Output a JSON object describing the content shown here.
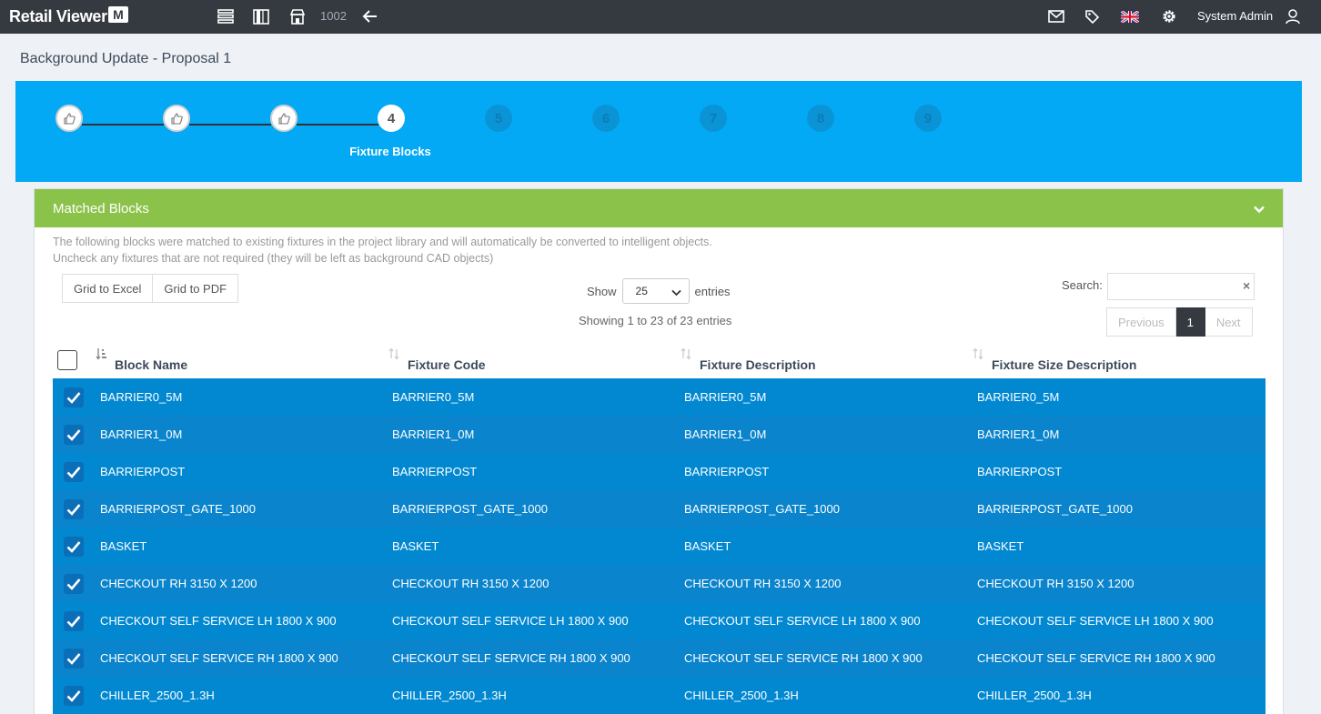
{
  "app": {
    "brand": "Retail Viewer",
    "brand_mark": "M",
    "nav_number": "1002",
    "user_name": "System Admin"
  },
  "page": {
    "title": "Background Update - Proposal 1"
  },
  "wizard": {
    "steps": [
      "",
      "",
      "",
      "4",
      "5",
      "6",
      "7",
      "8",
      "9"
    ],
    "current_label": "Fixture Blocks"
  },
  "panel": {
    "title": "Matched Blocks",
    "description_line1": "The following blocks were matched to existing fixtures in the project library and will automatically be converted to intelligent objects.",
    "description_line2": "Uncheck any fixtures that are not required (they will be left as background CAD objects)"
  },
  "toolbar": {
    "excel_label": "Grid to Excel",
    "pdf_label": "Grid to PDF"
  },
  "length": {
    "show_label": "Show",
    "value": "25",
    "entries_label": "entries"
  },
  "info": "Showing 1 to 23 of 23 entries",
  "search": {
    "label": "Search:",
    "value": "",
    "clear": "×"
  },
  "pager": {
    "previous": "Previous",
    "current": "1",
    "next": "Next"
  },
  "table": {
    "columns": [
      "Block Name",
      "Fixture Code",
      "Fixture Description",
      "Fixture Size Description"
    ],
    "rows": [
      [
        "BARRIER0_5M",
        "BARRIER0_5M",
        "BARRIER0_5M",
        "BARRIER0_5M"
      ],
      [
        "BARRIER1_0M",
        "BARRIER1_0M",
        "BARRIER1_0M",
        "BARRIER1_0M"
      ],
      [
        "BARRIERPOST",
        "BARRIERPOST",
        "BARRIERPOST",
        "BARRIERPOST"
      ],
      [
        "BARRIERPOST_GATE_1000",
        "BARRIERPOST_GATE_1000",
        "BARRIERPOST_GATE_1000",
        "BARRIERPOST_GATE_1000"
      ],
      [
        "BASKET",
        "BASKET",
        "BASKET",
        "BASKET"
      ],
      [
        "CHECKOUT RH 3150 X 1200",
        "CHECKOUT RH 3150 X 1200",
        "CHECKOUT RH 3150 X 1200",
        "CHECKOUT RH 3150 X 1200"
      ],
      [
        "CHECKOUT SELF SERVICE LH 1800 X 900",
        "CHECKOUT SELF SERVICE LH 1800 X 900",
        "CHECKOUT SELF SERVICE LH 1800 X 900",
        "CHECKOUT SELF SERVICE LH 1800 X 900"
      ],
      [
        "CHECKOUT SELF SERVICE RH 1800 X 900",
        "CHECKOUT SELF SERVICE RH 1800 X 900",
        "CHECKOUT SELF SERVICE RH 1800 X 900",
        "CHECKOUT SELF SERVICE RH 1800 X 900"
      ],
      [
        "CHILLER_2500_1.3H",
        "CHILLER_2500_1.3H",
        "CHILLER_2500_1.3H",
        "CHILLER_2500_1.3H"
      ]
    ]
  },
  "colors": {
    "topbar": "#343a40",
    "wizard": "#03a9f4",
    "panel_header": "#8bc34a",
    "row": "#0288d1"
  },
  "icons": [
    "list-icon",
    "columns-icon",
    "store-icon",
    "back-arrow-icon",
    "mail-icon",
    "tag-icon",
    "flag-uk-icon",
    "gear-icon",
    "user-icon",
    "thumbs-up-icon",
    "chevron-down-icon",
    "sort-icon",
    "checkmark-icon"
  ]
}
